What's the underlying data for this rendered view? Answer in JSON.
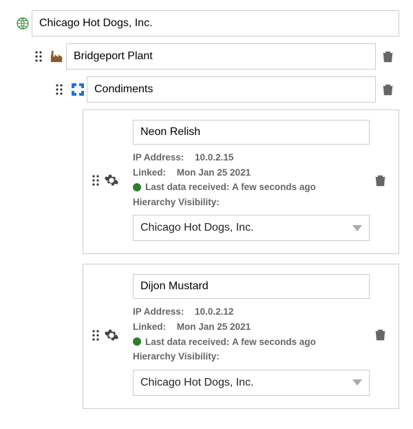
{
  "org": {
    "name": "Chicago Hot Dogs, Inc."
  },
  "plant": {
    "name": "Bridgeport Plant"
  },
  "group": {
    "name": "Condiments"
  },
  "devices": [
    {
      "name": "Neon Relish",
      "ip_label": "IP Address:",
      "ip": "10.0.2.15",
      "linked_label": "Linked:",
      "linked": "Mon Jan 25 2021",
      "last_data_label": "Last data received:",
      "last_data": "A few seconds ago",
      "hierarchy_label": "Hierarchy Visibility:",
      "hierarchy_value": "Chicago Hot Dogs, Inc.",
      "status_color": "#2e7d32"
    },
    {
      "name": "Dijon Mustard",
      "ip_label": "IP Address:",
      "ip": "10.0.2.12",
      "linked_label": "Linked:",
      "linked": "Mon Jan 25 2021",
      "last_data_label": "Last data received:",
      "last_data": "A few seconds ago",
      "hierarchy_label": "Hierarchy Visibility:",
      "hierarchy_value": "Chicago Hot Dogs, Inc.",
      "status_color": "#2e7d32"
    }
  ]
}
